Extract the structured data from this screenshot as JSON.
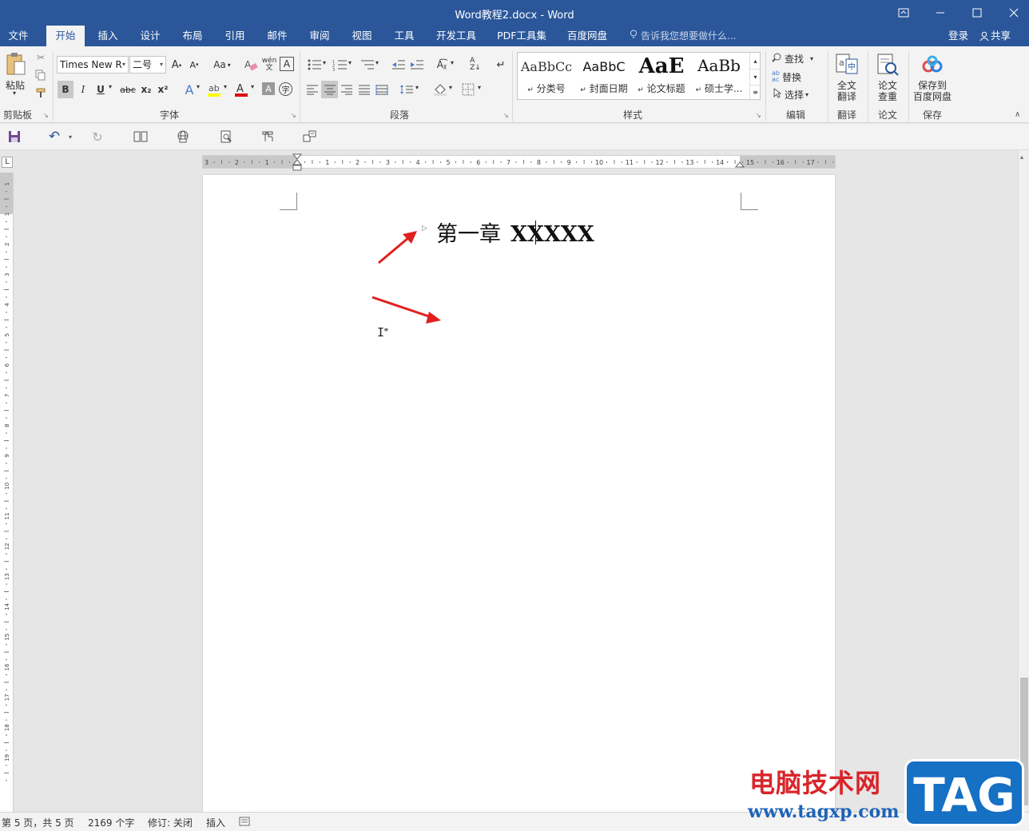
{
  "window": {
    "title": "Word教程2.docx - Word"
  },
  "tabs": [
    {
      "label": "文件"
    },
    {
      "label": "开始"
    },
    {
      "label": "插入"
    },
    {
      "label": "设计"
    },
    {
      "label": "布局"
    },
    {
      "label": "引用"
    },
    {
      "label": "邮件"
    },
    {
      "label": "审阅"
    },
    {
      "label": "视图"
    },
    {
      "label": "工具"
    },
    {
      "label": "开发工具"
    },
    {
      "label": "PDF工具集"
    },
    {
      "label": "百度网盘"
    }
  ],
  "tell_me": "告诉我您想要做什么...",
  "login": "登录",
  "share": "共享",
  "clipboard": {
    "paste_label": "粘贴",
    "group_label": "剪贴板"
  },
  "font": {
    "font_name": "Times New R",
    "font_size": "二号",
    "change_case": "Aa",
    "group_label": "字体",
    "bold": "B",
    "italic": "I",
    "underline": "U",
    "strike": "abc",
    "subscript": "x₂",
    "superscript": "x²"
  },
  "paragraph": {
    "group_label": "段落"
  },
  "styles": {
    "group_label": "样式",
    "items": [
      {
        "sample": "AaBbCc",
        "name": "分类号"
      },
      {
        "sample": "AaBbC",
        "name": "封面日期"
      },
      {
        "sample": "AaE",
        "name": "论文标题"
      },
      {
        "sample": "AaBb",
        "name": "硕士学..."
      }
    ]
  },
  "editing": {
    "find": "查找",
    "replace": "替换",
    "select": "选择",
    "group_label": "编辑"
  },
  "translate": {
    "button_label_1": "全文",
    "button_label_2": "翻译",
    "group_label": "翻译"
  },
  "paper": {
    "button_label_1": "论文",
    "button_label_2": "查重",
    "group_label": "论文"
  },
  "save": {
    "button_label_1": "保存到",
    "button_label_2": "百度网盘",
    "group_label": "保存"
  },
  "ruler": {
    "h_labels": [
      "3",
      "2",
      "1",
      "",
      "1",
      "2",
      "3",
      "4",
      "5",
      "6",
      "7",
      "8",
      "9",
      "10",
      "11",
      "12",
      "13",
      "14",
      "15",
      "16",
      "17"
    ],
    "v_labels": [
      "1",
      "1",
      "2",
      "3",
      "4",
      "5",
      "6",
      "7",
      "8",
      "9",
      "10",
      "11",
      "12",
      "13",
      "14",
      "15",
      "16",
      "17",
      "18",
      "19"
    ]
  },
  "document": {
    "heading_cn": "第一章",
    "heading_text": "XXXXX"
  },
  "status": {
    "page": "第 5 页，共 5 页",
    "words": "2169 个字",
    "track_changes": "修订: 关闭",
    "insert_mode": "插入"
  },
  "watermark": {
    "site_cn": "电脑技术网",
    "url": "www.tagxp.com",
    "tag": "TAG"
  },
  "colors": {
    "brand": "#2b579a",
    "arrow": "#e02020",
    "font_color": "#e00000",
    "highlight": "#ffff00"
  }
}
